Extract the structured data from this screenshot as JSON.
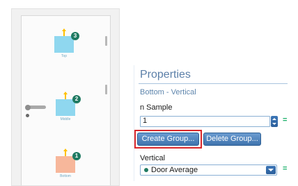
{
  "sensors": [
    {
      "badge": "3",
      "caption": "Top",
      "color": "#8fd7ef"
    },
    {
      "badge": "2",
      "caption": "Middle",
      "color": "#8fd7ef"
    },
    {
      "badge": "1",
      "caption": "Bottom",
      "color": "#f7b79b"
    }
  ],
  "panel": {
    "title": "Properties",
    "subtitle": "Bottom - Vertical",
    "n_sample_label": "n Sample",
    "n_sample_value": "1",
    "equals": "=",
    "create_group_label": "Create Group...",
    "delete_group_label": "Delete Group...",
    "vertical_label": "Vertical",
    "vertical_value": "Door Average"
  },
  "colors": {
    "accent": "#3f74ae",
    "highlight": "#d9262a",
    "badge": "#1f7a62"
  }
}
